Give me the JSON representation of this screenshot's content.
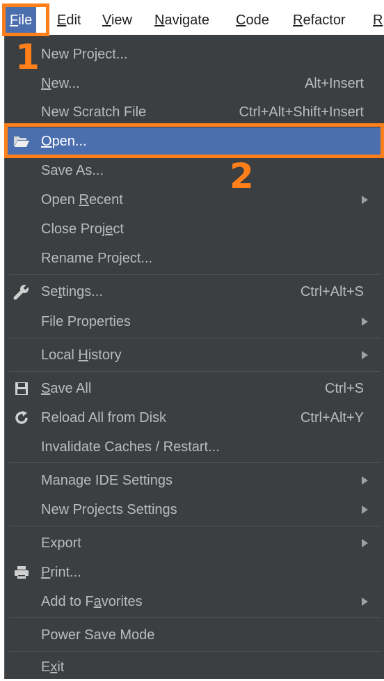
{
  "menubar": {
    "items": [
      {
        "pre": "",
        "mn": "F",
        "post": "ile"
      },
      {
        "pre": "",
        "mn": "E",
        "post": "dit"
      },
      {
        "pre": "",
        "mn": "V",
        "post": "iew"
      },
      {
        "pre": "",
        "mn": "N",
        "post": "avigate"
      },
      {
        "pre": "",
        "mn": "C",
        "post": "ode"
      },
      {
        "pre": "",
        "mn": "R",
        "post": "efactor"
      },
      {
        "pre": "",
        "mn": "R",
        "post": ""
      }
    ]
  },
  "file_menu": {
    "items": [
      {
        "pre": "New Project...",
        "mn": "",
        "post": "",
        "shortcut": ""
      },
      {
        "pre": "",
        "mn": "N",
        "post": "ew...",
        "shortcut": "Alt+Insert"
      },
      {
        "pre": "New Scratch File",
        "mn": "",
        "post": "",
        "shortcut": "Ctrl+Alt+Shift+Insert"
      },
      {
        "pre": "",
        "mn": "O",
        "post": "pen...",
        "shortcut": ""
      },
      {
        "pre": "Save As...",
        "mn": "",
        "post": "",
        "shortcut": ""
      },
      {
        "pre": "Open ",
        "mn": "R",
        "post": "ecent",
        "shortcut": ""
      },
      {
        "pre": "Close Proj",
        "mn": "e",
        "post": "ct",
        "shortcut": ""
      },
      {
        "pre": "Rename Project...",
        "mn": "",
        "post": "",
        "shortcut": ""
      },
      {
        "pre": "Se",
        "mn": "t",
        "post": "tings...",
        "shortcut": "Ctrl+Alt+S"
      },
      {
        "pre": "File Properties",
        "mn": "",
        "post": "",
        "shortcut": ""
      },
      {
        "pre": "Local ",
        "mn": "H",
        "post": "istory",
        "shortcut": ""
      },
      {
        "pre": "",
        "mn": "S",
        "post": "ave All",
        "shortcut": "Ctrl+S"
      },
      {
        "pre": "Reload All from Disk",
        "mn": "",
        "post": "",
        "shortcut": "Ctrl+Alt+Y"
      },
      {
        "pre": "Invalidate Caches / Restart...",
        "mn": "",
        "post": "",
        "shortcut": ""
      },
      {
        "pre": "Manage IDE Settings",
        "mn": "",
        "post": "",
        "shortcut": ""
      },
      {
        "pre": "New Projects Settings",
        "mn": "",
        "post": "",
        "shortcut": ""
      },
      {
        "pre": "Export",
        "mn": "",
        "post": "",
        "shortcut": ""
      },
      {
        "pre": "",
        "mn": "P",
        "post": "rint...",
        "shortcut": ""
      },
      {
        "pre": "Add to F",
        "mn": "a",
        "post": "vorites",
        "shortcut": ""
      },
      {
        "pre": "Power Save Mode",
        "mn": "",
        "post": "",
        "shortcut": ""
      },
      {
        "pre": "E",
        "mn": "x",
        "post": "it",
        "shortcut": ""
      }
    ]
  },
  "annotations": {
    "step1": "1",
    "step2": "2"
  },
  "icons": {
    "open": "folder-open-icon",
    "settings": "wrench-icon",
    "save_all": "floppy-disk-icon",
    "reload": "reload-icon",
    "print": "printer-icon"
  },
  "colors": {
    "selection": "#4b6eaf",
    "menu_background": "#3c3f41",
    "menu_text": "#bbbbbb",
    "annotation": "#ff7f1a"
  }
}
